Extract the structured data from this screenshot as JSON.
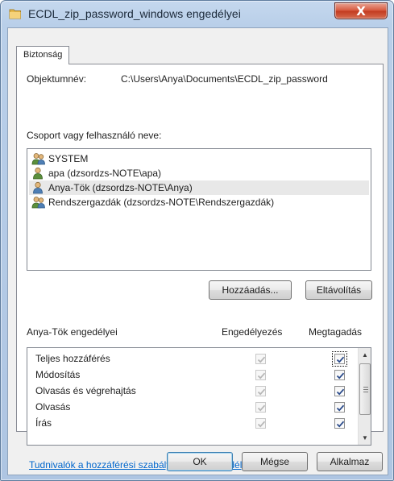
{
  "window": {
    "title": "ECDL_zip_password_windows engedélyei",
    "close_label": "X"
  },
  "tabs": [
    {
      "label": "Biztonság",
      "selected": true
    }
  ],
  "object": {
    "label": "Objektumnév:",
    "value": "C:\\Users\\Anya\\Documents\\ECDL_zip_password"
  },
  "principals": {
    "label": "Csoport vagy felhasználó neve:",
    "items": [
      {
        "name": "SYSTEM",
        "icon": "group-icon",
        "selected": false
      },
      {
        "name": "apa (dzsordzs-NOTE\\apa)",
        "icon": "user-icon",
        "selected": false
      },
      {
        "name": "Anya-Tök (dzsordzs-NOTE\\Anya)",
        "icon": "user-icon",
        "selected": true
      },
      {
        "name": "Rendszergazdák (dzsordzs-NOTE\\Rendszergazdák)",
        "icon": "group-icon",
        "selected": false
      }
    ],
    "add_button": "Hozzáadás...",
    "remove_button": "Eltávolítás"
  },
  "permissions": {
    "title": "Anya-Tök engedélyei",
    "allow_header": "Engedélyezés",
    "deny_header": "Megtagadás",
    "rows": [
      {
        "name": "Teljes hozzáférés",
        "allow": true,
        "allow_inherited": true,
        "deny": true
      },
      {
        "name": "Módosítás",
        "allow": true,
        "allow_inherited": true,
        "deny": true
      },
      {
        "name": "Olvasás és végrehajtás",
        "allow": true,
        "allow_inherited": true,
        "deny": true
      },
      {
        "name": "Olvasás",
        "allow": true,
        "allow_inherited": true,
        "deny": true
      },
      {
        "name": "Írás",
        "allow": true,
        "allow_inherited": true,
        "deny": true
      }
    ]
  },
  "info_link": "Tudnivalók a hozzáférési szabályokról és engedélyekről",
  "footer": {
    "ok": "OK",
    "cancel": "Mégse",
    "apply": "Alkalmaz"
  },
  "colors": {
    "frame": "#b9cfe9",
    "close_button": "#c23a1f",
    "link": "#0066cc",
    "selection": "#e8e8e8"
  }
}
